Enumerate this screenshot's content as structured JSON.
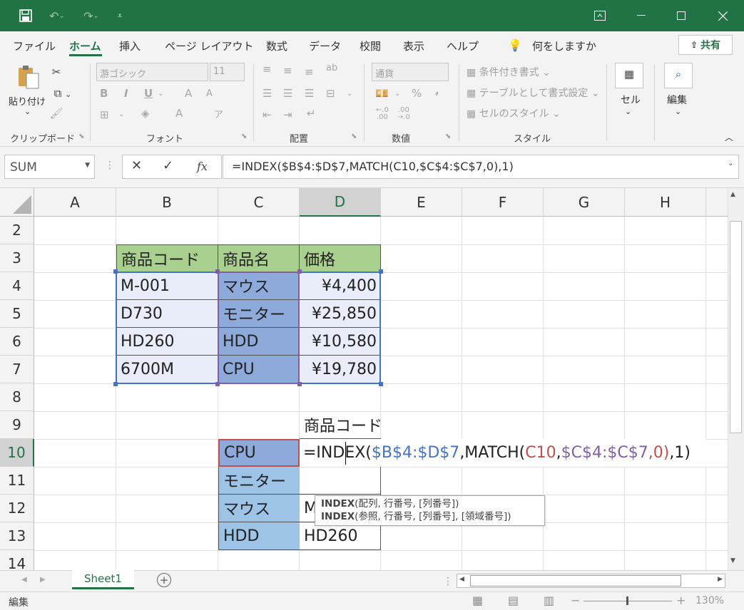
{
  "titlebar": {
    "save_icon": "save-icon",
    "undo_icon": "undo-icon",
    "redo_icon": "redo-icon",
    "customize_icon": "customize-icon",
    "ribbon_display_icon": "ribbon-display-icon",
    "minimize_icon": "minimize-icon",
    "maximize_icon": "maximize-icon",
    "close_icon": "close-icon"
  },
  "tabs": [
    {
      "label": "ファイル"
    },
    {
      "label": "ホーム"
    },
    {
      "label": "挿入"
    },
    {
      "label": "ページ レイアウト"
    },
    {
      "label": "数式"
    },
    {
      "label": "データ"
    },
    {
      "label": "校閲"
    },
    {
      "label": "表示"
    },
    {
      "label": "ヘルプ"
    }
  ],
  "tell_me": "何をしますか",
  "share_label": "共有",
  "ribbon": {
    "paste_label": "貼り付け",
    "font_name": "游ゴシック",
    "font_size": "11",
    "bold": "B",
    "italic": "I",
    "underline": "U",
    "grow_font": "A",
    "shrink_font": "A",
    "font_color": "A",
    "number_format": "通貨",
    "conditional_format": "条件付き書式",
    "format_as_table": "テーブルとして書式設定",
    "cell_styles": "セルのスタイル",
    "cells_label": "セル",
    "editing_label": "編集",
    "percent": "%",
    "comma": ",",
    "groups": {
      "clipboard": "クリップボード",
      "font": "フォント",
      "alignment": "配置",
      "number": "数値",
      "styles": "スタイル"
    }
  },
  "formula_bar": {
    "name_box": "SUM",
    "fx": "fx",
    "formula": "=INDEX($B$4:$D$7,MATCH(C10,$C$4:$C$7,0),1)"
  },
  "grid": {
    "columns": [
      "A",
      "B",
      "C",
      "D",
      "E",
      "F",
      "G",
      "H"
    ],
    "rows": [
      "2",
      "3",
      "4",
      "5",
      "6",
      "7",
      "8",
      "9",
      "10",
      "11",
      "12",
      "13",
      "14"
    ],
    "header": {
      "code": "商品コード",
      "name": "商品名",
      "price": "価格"
    },
    "table": [
      {
        "code": "M-001",
        "name": "マウス",
        "price": "¥4,400"
      },
      {
        "code": "D730",
        "name": "モニター",
        "price": "¥25,850"
      },
      {
        "code": "HD260",
        "name": "HDD",
        "price": "¥10,580"
      },
      {
        "code": "6700M",
        "name": "CPU",
        "price": "¥19,780"
      }
    ],
    "lookup_header": "商品コード",
    "lookup": [
      {
        "name": "CPU",
        "result": ""
      },
      {
        "name": "モニター",
        "result": ""
      },
      {
        "name": "マウス",
        "result": "M"
      },
      {
        "name": "HDD",
        "result": "HD260"
      }
    ],
    "edit_formula": {
      "p1": "=INDEX(",
      "p2": "$B$4:$D$7",
      "p3": ",MATCH(",
      "p4": "C10",
      "p5": ",",
      "p6": "$C$4:$C$7",
      "p7": ",0)",
      "p8": ",1)"
    }
  },
  "tooltip": {
    "line1_fn": "INDEX",
    "line1_args": "(配列, 行番号, [列番号])",
    "line2_fn": "INDEX",
    "line2_args": "(参照, 行番号, [列番号], [領域番号])"
  },
  "sheet_tab": "Sheet1",
  "status": {
    "mode": "編集",
    "zoom": "130%"
  },
  "colors": {
    "accent": "#217346",
    "header_green": "#a9d08e",
    "blue_ref": "#4472c4",
    "purple_ref": "#7f5fa8",
    "red_ref": "#c0504d"
  }
}
